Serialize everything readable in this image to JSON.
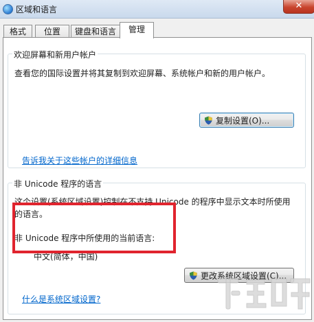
{
  "window": {
    "title": "区域和语言",
    "close_label": "✕"
  },
  "tabs": [
    {
      "label": "格式",
      "active": false
    },
    {
      "label": "位置",
      "active": false
    },
    {
      "label": "键盘和语言",
      "active": false
    },
    {
      "label": "管理",
      "active": true
    }
  ],
  "welcome_group": {
    "title": "欢迎屏幕和新用户帐户",
    "description": "查看您的国际设置并将其复制到欢迎屏幕、系统帐户和新的用户帐户。",
    "copy_button": "复制设置(O)...",
    "info_link": "告诉我关于这些帐户的详细信息"
  },
  "unicode_group": {
    "title": "非 Unicode 程序的语言",
    "description_line1": "这个设置(系统区域设置)控制在不支持 Unicode 的程序中显示文本时所使用",
    "description_line2": "的语言。",
    "current_label": "非 Unicode 程序中所使用的当前语言:",
    "current_value": "中文(简体，中国)",
    "change_button": "更改系统区域设置(C)...",
    "help_link": "什么是系统区域设置?"
  },
  "colors": {
    "highlight": "#e0242e",
    "link": "#0066cc"
  }
}
